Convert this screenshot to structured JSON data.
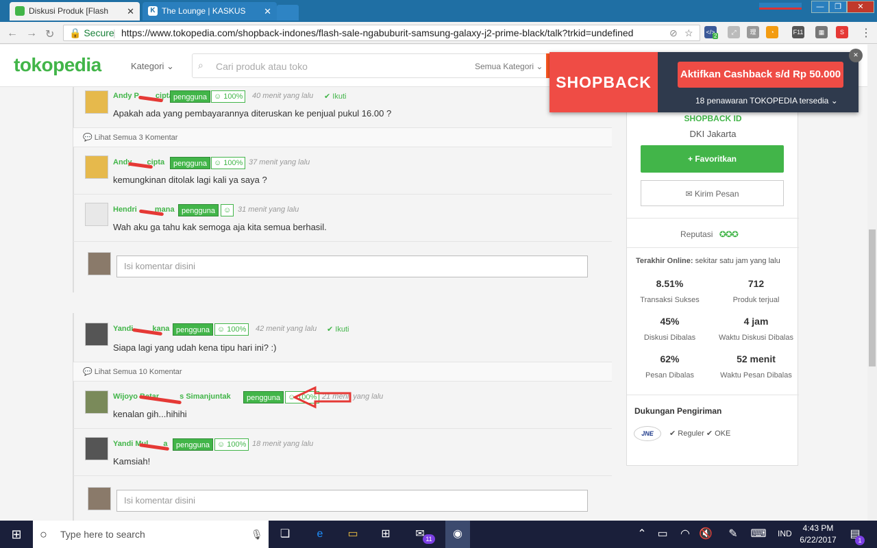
{
  "browser": {
    "tabs": [
      {
        "title": "Diskusi Produk [Flash Sal",
        "active": true
      },
      {
        "title": "The Lounge | KASKUS",
        "active": false
      }
    ],
    "secure_label": "Secure",
    "url": "https://www.tokopedia.com/shopback-indones/flash-sale-ngabuburit-samsung-galaxy-j2-prime-black/talk?trkid=undefined",
    "ext_badge": "2"
  },
  "header": {
    "logo": "tokopedia",
    "kategori": "Kategori",
    "search_placeholder": "Cari produk atau toko",
    "search_category": "Semua Kategori"
  },
  "shopback": {
    "logo": "SHOPBACK",
    "button": "Aktifkan Cashback s/d Rp 50.000",
    "subtitle": "18 penawaran TOKOPEDIA tersedia",
    "close": "×"
  },
  "thread1": {
    "top": {
      "name": "Andy P",
      "name_rest": "cipta",
      "badge": "pengguna",
      "rep": "100%",
      "time": "40 menit yang lalu",
      "follow": "Ikuti",
      "message": "Apakah ada yang pembayarannya diteruskan ke penjual pukul 16.00 ?"
    },
    "more": "Lihat Semua 3 Komentar",
    "replies": [
      {
        "name": "Andy",
        "name_rest": "cipta",
        "badge": "pengguna",
        "rep": "100%",
        "time": "37 menit yang lalu",
        "message": "kemungkinan ditolak lagi kali ya saya ?"
      },
      {
        "name": "Hendri",
        "name_rest": "mana",
        "badge": "pengguna",
        "rep": "",
        "time": "31 menit yang lalu",
        "message": "Wah aku ga tahu kak semoga aja kita semua berhasil."
      }
    ],
    "comment_placeholder": "Isi komentar disini"
  },
  "thread2": {
    "top": {
      "name": "Yandi",
      "name_rest": "kana",
      "badge": "pengguna",
      "rep": "100%",
      "time": "42 menit yang lalu",
      "follow": "Ikuti",
      "message": "Siapa lagi yang udah kena tipu hari ini? :)"
    },
    "more": "Lihat Semua 10 Komentar",
    "replies": [
      {
        "name": "Wijoyo Batar",
        "name_rest": "s Simanjuntak",
        "badge": "pengguna",
        "rep": "100%",
        "time": "21 menit yang lalu",
        "message": "kenalan gih...hihihi"
      },
      {
        "name": "Yandi Mul",
        "name_rest": "a",
        "badge": "pengguna",
        "rep": "100%",
        "time": "18 menit yang lalu",
        "message": "Kamsiah!"
      }
    ],
    "comment_placeholder": "Isi komentar disini"
  },
  "shop": {
    "name": "SHOPBACK ID",
    "location": "DKI Jakarta",
    "favorite": "+ Favoritkan",
    "message": "✉ Kirim Pesan",
    "reputation": "Reputasi",
    "last_online_label": "Terakhir Online:",
    "last_online_value": "sekitar satu jam yang lalu",
    "stats": [
      {
        "value": "8.51%",
        "label": "Transaksi Sukses"
      },
      {
        "value": "712",
        "label": "Produk terjual"
      },
      {
        "value": "45%",
        "label": "Diskusi Dibalas"
      },
      {
        "value": "4 jam",
        "label": "Waktu Diskusi Dibalas"
      },
      {
        "value": "62%",
        "label": "Pesan Dibalas"
      },
      {
        "value": "52 menit",
        "label": "Waktu Pesan Dibalas"
      }
    ],
    "shipping_title": "Dukungan Pengiriman",
    "courier": "JNE",
    "shipping_options": "✔ Reguler ✔ OKE"
  },
  "taskbar": {
    "search": "Type here to search",
    "mail_badge": "11",
    "lang": "IND",
    "time": "4:43 PM",
    "date": "6/22/2017",
    "notif": "1"
  }
}
